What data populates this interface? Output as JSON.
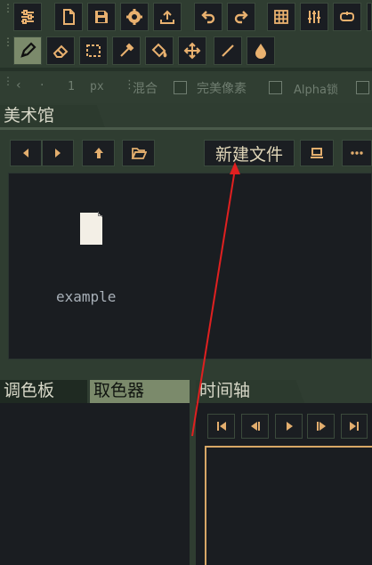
{
  "toolbar": {
    "row1_icons": [
      "settings-sliders-icon",
      "new-file-icon",
      "save-icon",
      "gear-icon",
      "export-icon",
      "undo-icon",
      "redo-icon",
      "grid-icon",
      "equalizer-icon",
      "loop-icon"
    ],
    "row2_icons": [
      "pencil-icon",
      "eraser-icon",
      "rect-select-icon",
      "eyedropper-icon",
      "bucket-fill-icon",
      "move-icon",
      "line-icon",
      "drop-icon"
    ]
  },
  "options": {
    "arrow_left": "‹",
    "dot": "·",
    "brush_size": "1",
    "unit": "px",
    "blend_label": "混合",
    "pixel_perfect_label": "完美像素",
    "alpha_lock_label": "Alpha锁"
  },
  "gallery": {
    "tab_title": "美术馆",
    "new_file_button": "新建文件",
    "file": {
      "name": "example"
    }
  },
  "bottom": {
    "palette_tab": "调色板",
    "picker_tab": "取色器",
    "timeline_tab": "时间轴"
  },
  "colors": {
    "accent": "#e9b16f",
    "frame_border": "#d7a766",
    "annotation_arrow": "#e02020"
  }
}
